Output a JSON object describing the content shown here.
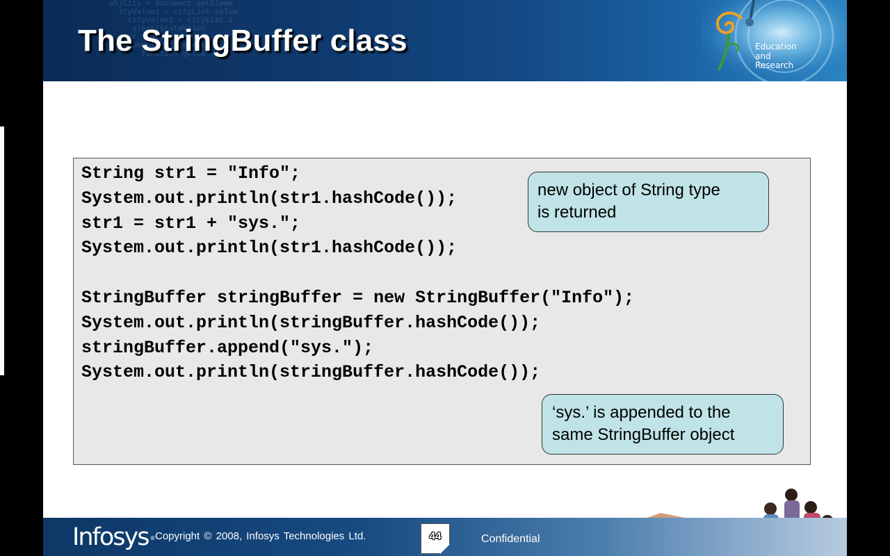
{
  "slide": {
    "title": "The StringBuffer class",
    "logo_text": [
      "Education",
      "and",
      "Research"
    ],
    "logo_icon": "education-research-swirl-logo"
  },
  "code": {
    "lines": [
      "String str1 = \"Info\";",
      "System.out.println(str1.hashCode());",
      "str1 = str1 + \"sys.\";",
      "System.out.println(str1.hashCode());",
      "",
      "StringBuffer stringBuffer = new StringBuffer(\"Info\");",
      "System.out.println(stringBuffer.hashCode());",
      "stringBuffer.append(\"sys.\");",
      "System.out.println(stringBuffer.hashCode());"
    ]
  },
  "callouts": [
    {
      "lines": [
        " new object of String type",
        "is returned"
      ]
    },
    {
      "lines": [
        "‘sys.’ is appended to the",
        "same StringBuffer object"
      ]
    }
  ],
  "footer": {
    "brand": "Infosys",
    "brand_mark": "®",
    "copyright": "Copyright © 2008, Infosys  Technologies  Ltd.",
    "page_number": "44",
    "confidential": "Confidential"
  },
  "colors": {
    "header_blue": "#0f3a6e",
    "callout_fill": "#bfe3e6",
    "code_bg": "#e8e8e8"
  }
}
